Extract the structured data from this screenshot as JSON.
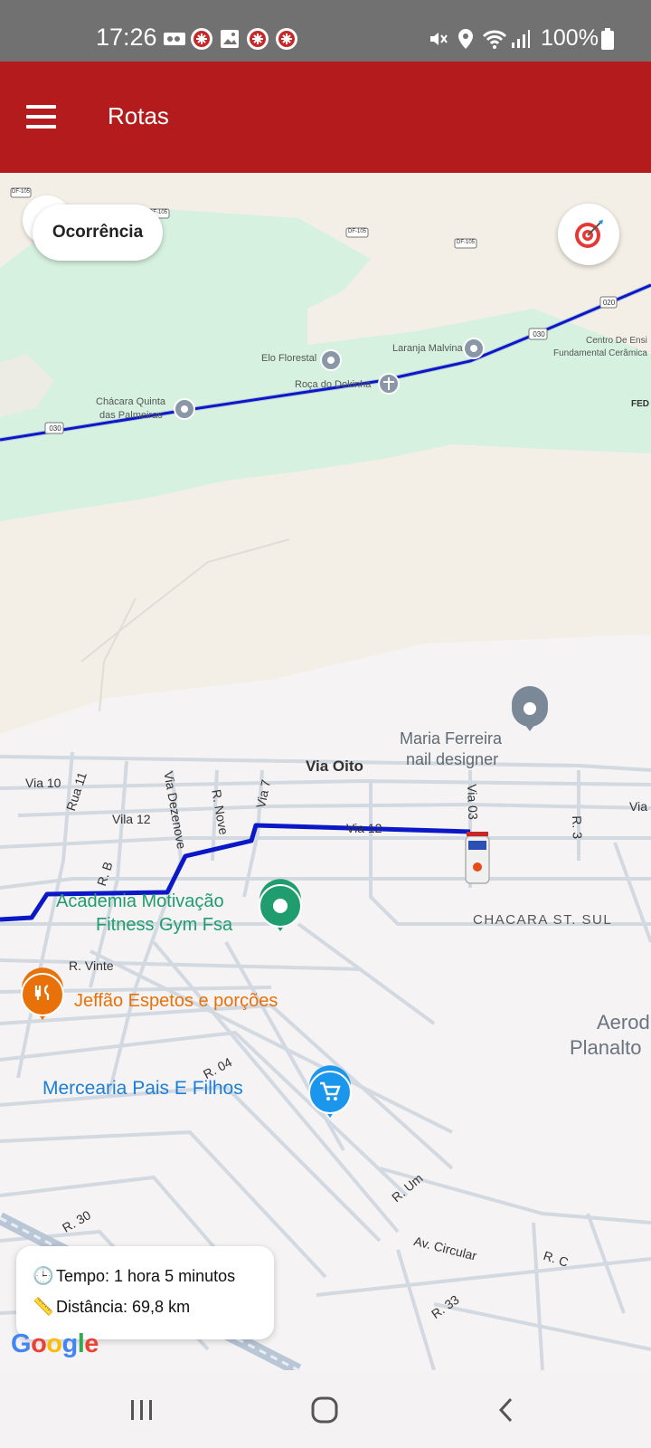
{
  "status_bar": {
    "time": "17:26",
    "battery": "100%"
  },
  "app_bar": {
    "title": "Rotas",
    "background": "#b31b1c"
  },
  "map": {
    "occurrence_button": "Ocorrência",
    "labels": {
      "elo_florestal": "Elo Florestal",
      "laranja_malvina": "Laranja Malvina",
      "roca_dokinha": "Roça do Dokinha",
      "chacara_quinta_1": "Chácara Quinta",
      "chacara_quinta_2": "das Palmeiras",
      "centro_1": "Centro De Ensi",
      "centro_2": "Fundamental Cerâmica",
      "fed": "FED",
      "shield_030_a": "030",
      "shield_030_b": "030",
      "shield_020": "020",
      "shield_df105_a": "DF-105",
      "shield_df105_b": "DF-105",
      "shield_df105_c": "DF-105",
      "shield_df105_d": "DF-105",
      "maria_1": "Maria Ferreira",
      "maria_2": "nail designer",
      "via_oito": "Via Oito",
      "via_10": "Via 10",
      "via_12_left": "Vila 12",
      "via_12": "Via 12",
      "rua_11": "Rua 11",
      "via_dezenove": "Via Dezenove",
      "r_nove": "R. Nove",
      "via_7": "Via 7",
      "via_03": "Via 03",
      "r3": "R. 3",
      "via_right": "Via",
      "r_b": "R. B",
      "chacara_st_sul": "CHACARA ST. SUL",
      "academia_1": "Academia Motivação",
      "academia_2": "Fitness Gym Fsa",
      "r_vinte": "R. Vinte",
      "jeffao": "Jeffão Espetos e porções",
      "aero_1": "Aerod",
      "aero_2": "Planalto",
      "r_04": "R. 04",
      "mercearia": "Mercearia Pais E Filhos",
      "r_um": "R. Um",
      "r_30": "R. 30",
      "av_circular": "Av. Circular",
      "r_c": "R. C",
      "r_33": "R. 33"
    },
    "route_color": "#0a18c8",
    "google": "Google"
  },
  "route_info": {
    "time_icon": "clock-icon",
    "time_text": "Tempo: 1 hora 5 minutos",
    "distance_icon": "ruler-icon",
    "distance_text": "Distância: 69,8 km"
  },
  "nav_bar": {
    "recents_icon": "recents-icon",
    "home_icon": "home-icon",
    "back_icon": "back-icon"
  }
}
